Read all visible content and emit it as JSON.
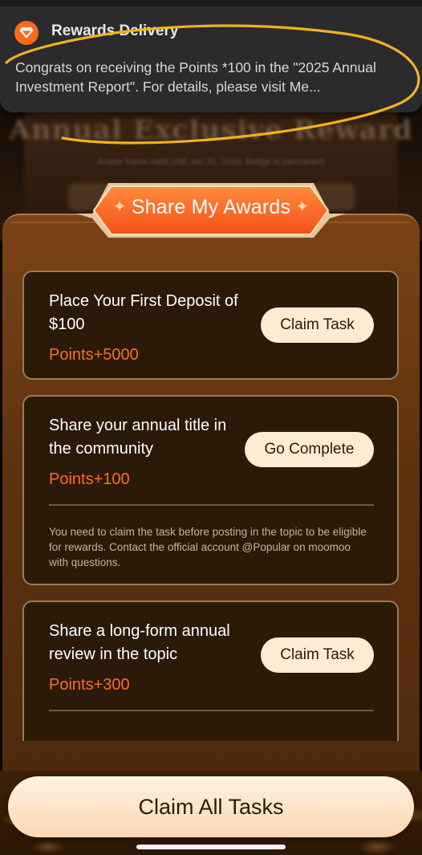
{
  "background": {
    "title": "Annual Exclusive Reward",
    "subtitle": "Avatar frame valid until Jan 31, 2026, Badge is permanent"
  },
  "notification": {
    "app_icon": "diamond-icon",
    "title": "Rewards Delivery",
    "body": "Congrats on receiving the Points *100 in the \"2025 Annual Investment Report\". For details, please visit Me..."
  },
  "header": {
    "title": "Share My Awards",
    "star_glyph": "✦"
  },
  "tasks": [
    {
      "title": "Place Your First Deposit of $100",
      "points": "Points+5000",
      "button": "Claim Task"
    },
    {
      "title": "Share your annual title in the community",
      "points": "Points+100",
      "button": "Go Complete",
      "note": "You need to claim the task before posting in the topic to be eligible for rewards. Contact the official account @Popular on moomoo with questions."
    },
    {
      "title": "Share a long-form annual review in the topic",
      "points": "Points+300",
      "button": "Claim Task"
    }
  ],
  "footer": {
    "claim_all_label": "Claim All Tasks"
  },
  "colors": {
    "accent_orange": "#ff6b25",
    "panel_brown": "#5e320f",
    "card_bg": "#2b1a08",
    "button_cream": "#fdebd3",
    "annotation_yellow": "#f2b21b"
  }
}
